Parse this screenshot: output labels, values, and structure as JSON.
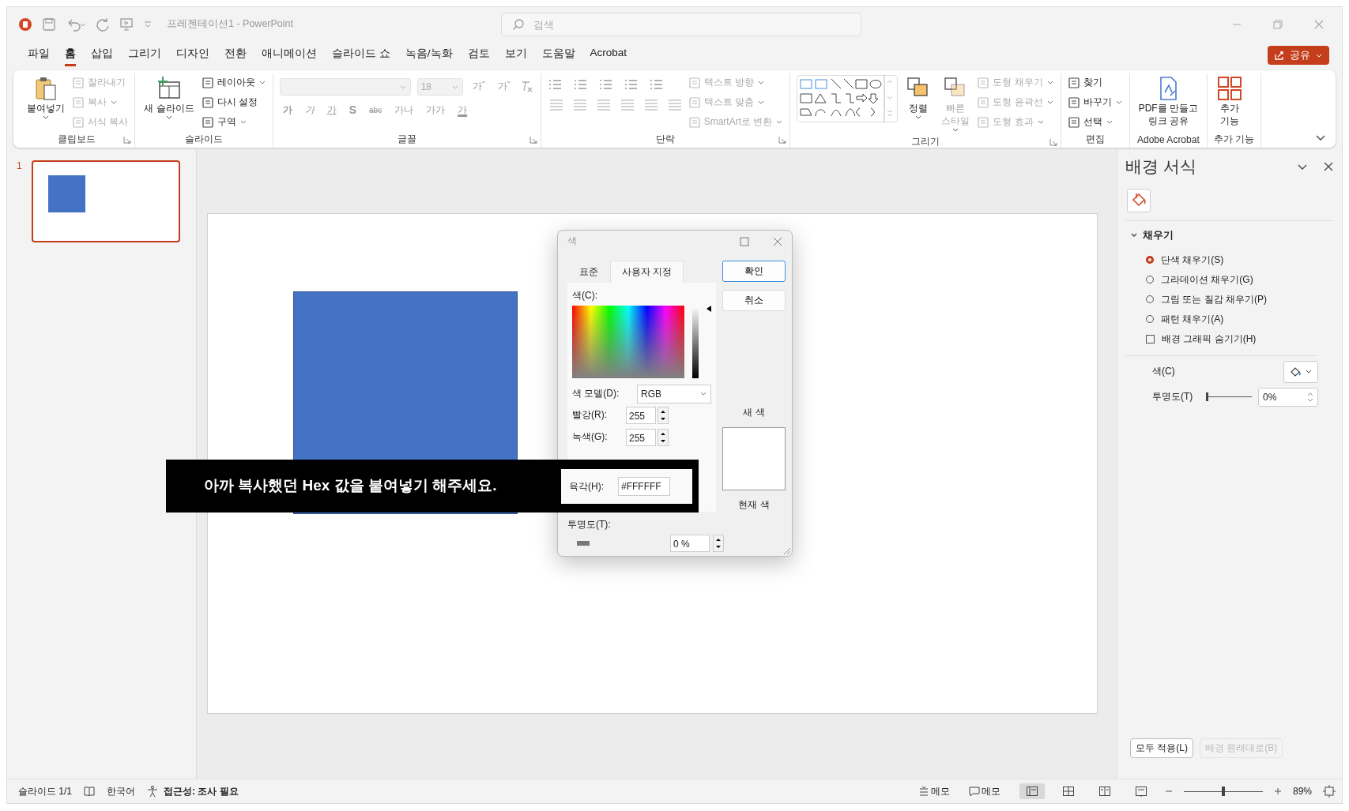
{
  "window": {
    "title": "프레젠테이션1  -  PowerPoint",
    "search_placeholder": "검색",
    "share_label": "공유"
  },
  "menu_tabs": [
    {
      "label": "파일",
      "selected": false
    },
    {
      "label": "홈",
      "selected": true
    },
    {
      "label": "삽입",
      "selected": false
    },
    {
      "label": "그리기",
      "selected": false
    },
    {
      "label": "디자인",
      "selected": false
    },
    {
      "label": "전환",
      "selected": false
    },
    {
      "label": "애니메이션",
      "selected": false
    },
    {
      "label": "슬라이드 쇼",
      "selected": false
    },
    {
      "label": "녹음/녹화",
      "selected": false
    },
    {
      "label": "검토",
      "selected": false
    },
    {
      "label": "보기",
      "selected": false
    },
    {
      "label": "도움말",
      "selected": false
    },
    {
      "label": "Acrobat",
      "selected": false
    }
  ],
  "ribbon": [
    {
      "kind": "clipboard",
      "label": "클립보드",
      "launcher": true,
      "items": [
        {
          "label": "붙여넣기",
          "kind": "large",
          "dropdown": true,
          "disabled": false
        },
        {
          "label": "잘라내기",
          "kind": "small",
          "dropdown": false,
          "disabled": true
        },
        {
          "label": "복사",
          "kind": "small",
          "dropdown": true,
          "disabled": true
        },
        {
          "label": "서식 복사",
          "kind": "small",
          "dropdown": false,
          "disabled": true
        }
      ]
    },
    {
      "kind": "slides",
      "label": "슬라이드",
      "launcher": false,
      "items": [
        {
          "label": "새 슬라이드",
          "kind": "large",
          "dropdown": true,
          "disabled": false
        },
        {
          "label": "레이아웃",
          "kind": "small",
          "dropdown": true,
          "disabled": false
        },
        {
          "label": "다시 설정",
          "kind": "small",
          "dropdown": false,
          "disabled": false
        },
        {
          "label": "구역",
          "kind": "small",
          "dropdown": true,
          "disabled": false
        }
      ]
    },
    {
      "kind": "font",
      "label": "글꼴",
      "launcher": true,
      "size_value": "18",
      "grow_buttons": [
        "가ˆ",
        "가ˇ"
      ],
      "format_buttons": [
        "가",
        "가",
        "가",
        "S",
        "abc",
        "가나",
        "가가",
        "가"
      ]
    },
    {
      "kind": "paragraph",
      "label": "단락",
      "launcher": true,
      "items": [
        {
          "label": "텍스트 방향",
          "kind": "small",
          "dropdown": true,
          "disabled": true
        },
        {
          "label": "텍스트 맞춤",
          "kind": "small",
          "dropdown": true,
          "disabled": true
        },
        {
          "label": "SmartArt로 변환",
          "kind": "small",
          "dropdown": true,
          "disabled": true
        }
      ]
    },
    {
      "kind": "drawing",
      "label": "그리기",
      "launcher": true,
      "items": [
        {
          "label": "정렬",
          "kind": "large",
          "dropdown": true,
          "disabled": false
        },
        {
          "label": "빠른\n스타일",
          "kind": "large",
          "dropdown": true,
          "disabled": true
        },
        {
          "label": "도형 채우기",
          "kind": "small",
          "dropdown": true,
          "disabled": true
        },
        {
          "label": "도형 윤곽선",
          "kind": "small",
          "dropdown": true,
          "disabled": true
        },
        {
          "label": "도형 효과",
          "kind": "small",
          "dropdown": true,
          "disabled": true
        }
      ]
    },
    {
      "kind": "editing",
      "label": "편집",
      "launcher": false,
      "items": [
        {
          "label": "찾기",
          "kind": "small",
          "dropdown": false,
          "disabled": false
        },
        {
          "label": "바꾸기",
          "kind": "small",
          "dropdown": true,
          "disabled": false
        },
        {
          "label": "선택",
          "kind": "small",
          "dropdown": true,
          "disabled": false
        }
      ]
    },
    {
      "kind": "acrobat",
      "label": "Adobe Acrobat",
      "launcher": false,
      "items": [
        {
          "label": "PDF를 만들고\n링크 공유",
          "kind": "large",
          "dropdown": false,
          "disabled": false
        }
      ]
    },
    {
      "kind": "addins",
      "label": "추가 기능",
      "launcher": false,
      "items": [
        {
          "label": "추가\n기능",
          "kind": "large",
          "dropdown": false,
          "disabled": false
        }
      ]
    }
  ],
  "slides": [
    {
      "number": "1",
      "selected": true
    }
  ],
  "color_dialog": {
    "title": "색",
    "tabs": [
      {
        "label": "표준",
        "selected": false
      },
      {
        "label": "사용자 지정",
        "selected": true
      }
    ],
    "buttons": [
      {
        "label": "확인",
        "default": true
      },
      {
        "label": "취소",
        "default": false
      }
    ],
    "colors_label": "색(C):",
    "model_label": "색 모델(D):",
    "model_value": "RGB",
    "channels": [
      {
        "label": "빨강(R):",
        "value": "255"
      },
      {
        "label": "녹색(G):",
        "value": "255"
      }
    ],
    "hex_label": "육각(H):",
    "hex_value": "#FFFFFF",
    "transparency_label": "투명도(T):",
    "transparency_value": "0 %",
    "new_label": "새 색",
    "current_label": "현재 색"
  },
  "overlay_caption": "아까 복사했던 Hex 값을 붙여넣기 해주세요.",
  "format_pane": {
    "title": "배경 서식",
    "section": {
      "label": "채우기",
      "expanded": true
    },
    "options": [
      {
        "kind": "radio",
        "label": "단색 채우기(S)",
        "selected": true
      },
      {
        "kind": "radio",
        "label": "그라데이션 채우기(G)",
        "selected": false
      },
      {
        "kind": "radio",
        "label": "그림 또는 질감 채우기(P)",
        "selected": false
      },
      {
        "kind": "radio",
        "label": "패턴 채우기(A)",
        "selected": false
      },
      {
        "kind": "checkbox",
        "label": "배경 그래픽 숨기기(H)",
        "checked": false
      }
    ],
    "color_label": "색(C)",
    "transparency": {
      "label": "투명도(T)",
      "level": 0,
      "value": "0%"
    },
    "buttons": [
      {
        "label": "모두 적용(L)",
        "disabled": false
      },
      {
        "label": "배경 원래대로(B)",
        "disabled": true
      }
    ]
  },
  "status_bar": {
    "slide_info": "슬라이드 1/1",
    "language": "한국어",
    "accessibility": "접근성: 조사 필요",
    "notes_label": "메모",
    "comments_label": "메모",
    "views": [
      {
        "selected": true
      },
      {
        "selected": false
      },
      {
        "selected": false
      },
      {
        "selected": false
      }
    ],
    "zoom": {
      "level": 0.5,
      "reading": "89%"
    }
  }
}
